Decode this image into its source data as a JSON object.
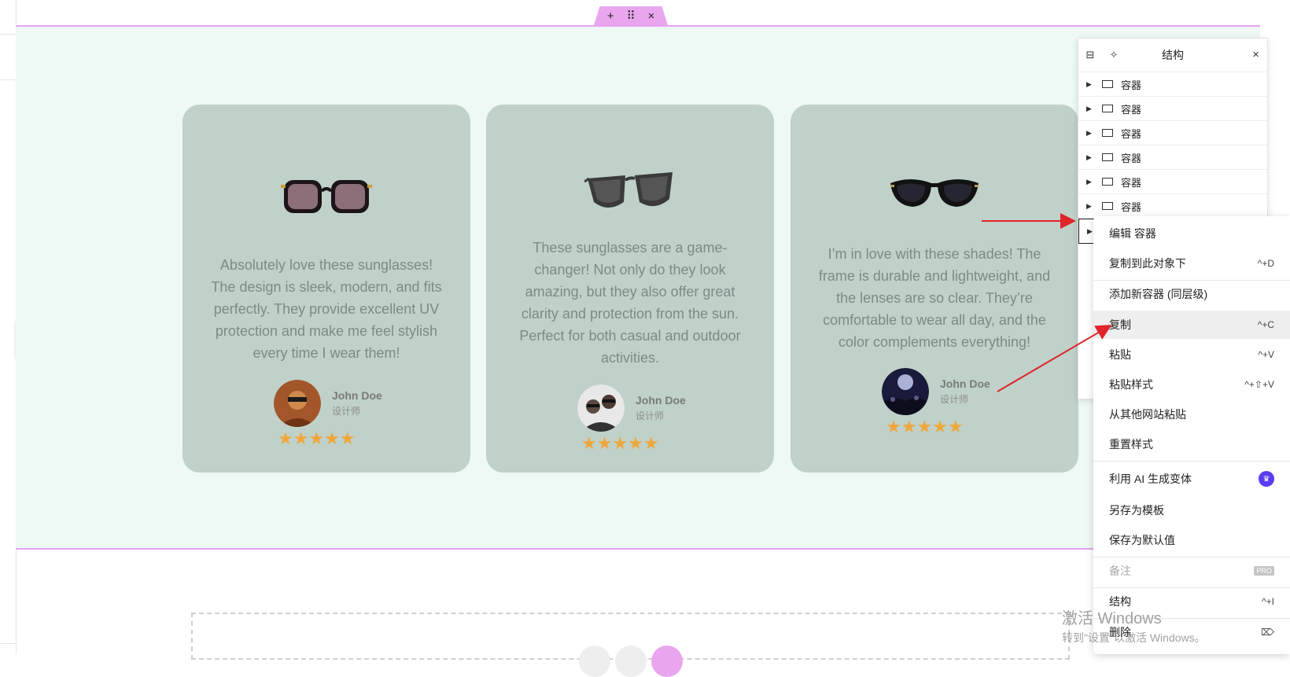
{
  "handle": {
    "add": "+",
    "move": "⠿",
    "close": "×"
  },
  "collapse_arrow": "‹",
  "cards": [
    {
      "quote": "Absolutely love these sunglasses! The design is sleek, modern, and fits perfectly. They provide excellent UV protection and make me feel stylish every time I wear them!",
      "name": "John Doe",
      "role": "设计师",
      "stars": "★★★★★"
    },
    {
      "quote": "These sunglasses are a game-changer! Not only do they look amazing, but they also offer great clarity and protection from the sun. Perfect for both casual and outdoor activities.",
      "name": "John Doe",
      "role": "设计师",
      "stars": "★★★★★"
    },
    {
      "quote": "I’m in love with these shades! The frame is durable and lightweight, and the lenses are so clear. They’re comfortable to wear all day, and the color complements everything!",
      "name": "John Doe",
      "role": "设计师",
      "stars": "★★★★★"
    }
  ],
  "structure_panel": {
    "title": "结构",
    "close": "×",
    "items": [
      "容器",
      "容器",
      "容器",
      "容器",
      "容器",
      "容器"
    ]
  },
  "context_menu": {
    "items": [
      {
        "label": "编辑 容器",
        "shortcut": ""
      },
      {
        "label": "复制到此对象下",
        "shortcut": "^+D"
      },
      {
        "label": "添加新容器 (同层级)",
        "shortcut": ""
      },
      {
        "label": "复制",
        "shortcut": "^+C"
      },
      {
        "label": "粘贴",
        "shortcut": "^+V"
      },
      {
        "label": "粘贴样式",
        "shortcut": "^+⇧+V"
      },
      {
        "label": "从其他网站粘贴",
        "shortcut": ""
      },
      {
        "label": "重置样式",
        "shortcut": ""
      },
      {
        "label": "利用 AI 生成变体",
        "shortcut": ""
      },
      {
        "label": "另存为模板",
        "shortcut": ""
      },
      {
        "label": "保存为默认值",
        "shortcut": ""
      },
      {
        "label": "备注",
        "shortcut": "PRO"
      },
      {
        "label": "结构",
        "shortcut": "^+I"
      },
      {
        "label": "删除",
        "shortcut": "⌦"
      }
    ]
  },
  "watermark": {
    "line1": "激活 Windows",
    "line2": "转到\"设置\"以激活 Windows。"
  },
  "colors": {
    "section_bg": "#eef8f4",
    "card_bg": "#bfd1c8",
    "star": "#f0a63b",
    "accent_pink": "#e7a3ee",
    "ai_badge": "#5b3cf0"
  }
}
